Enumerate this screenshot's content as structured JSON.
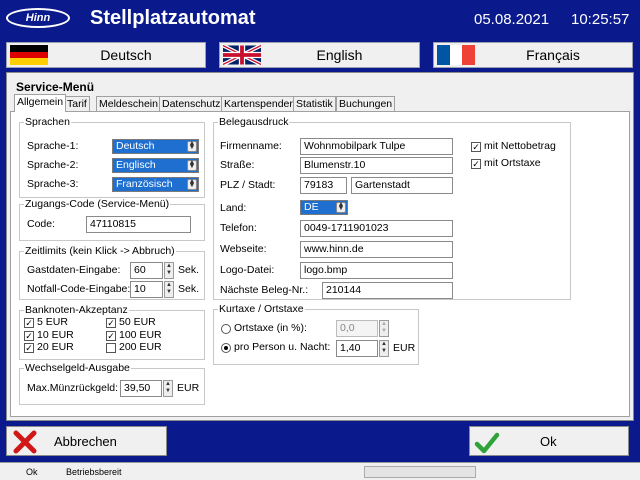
{
  "header": {
    "logo_text": "Hinn",
    "title": "Stellplatzautomat",
    "date": "05.08.2021",
    "time": "10:25:57"
  },
  "languages": [
    {
      "label": "Deutsch"
    },
    {
      "label": "English"
    },
    {
      "label": "Français"
    }
  ],
  "menu_title": "Service-Menü",
  "tabs": [
    "Allgemein",
    "Tarif",
    "Meldeschein",
    "Datenschutz",
    "Kartenspender",
    "Statistik",
    "Buchungen"
  ],
  "sprachen": {
    "legend": "Sprachen",
    "rows": [
      {
        "label": "Sprache-1:",
        "value": "Deutsch"
      },
      {
        "label": "Sprache-2:",
        "value": "Englisch"
      },
      {
        "label": "Sprache-3:",
        "value": "Französisch"
      }
    ]
  },
  "zugang": {
    "legend": "Zugangs-Code (Service-Menü)",
    "label": "Code:",
    "value": "47110815"
  },
  "zeitlimits": {
    "legend": "Zeitlimits (kein Klick -> Abbruch)",
    "rows": [
      {
        "label": "Gastdaten-Eingabe:",
        "value": "60",
        "unit": "Sek."
      },
      {
        "label": "Notfall-Code-Eingabe:",
        "value": "10",
        "unit": "Sek."
      }
    ]
  },
  "banknoten": {
    "legend": "Banknoten-Akzeptanz",
    "items": [
      {
        "label": "5 EUR",
        "checked": true
      },
      {
        "label": "50 EUR",
        "checked": true
      },
      {
        "label": "10 EUR",
        "checked": true
      },
      {
        "label": "100 EUR",
        "checked": true
      },
      {
        "label": "20 EUR",
        "checked": true
      },
      {
        "label": "200 EUR",
        "checked": false
      }
    ]
  },
  "wechselgeld": {
    "legend": "Wechselgeld-Ausgabe",
    "label": "Max.Münzrückgeld:",
    "value": "39,50",
    "unit": "EUR"
  },
  "beleg": {
    "legend": "Belegausdruck",
    "fields": [
      {
        "label": "Firmenname:",
        "value": "Wohnmobilpark Tulpe"
      },
      {
        "label": "Straße:",
        "value": "Blumenstr.10"
      },
      {
        "label": "PLZ / Stadt:",
        "value": "79183",
        "value2": "Gartenstadt"
      },
      {
        "label": "Land:",
        "value": "DE"
      },
      {
        "label": "Telefon:",
        "value": "0049-1711901023"
      },
      {
        "label": "Webseite:",
        "value": "www.hinn.de"
      },
      {
        "label": "Logo-Datei:",
        "value": "logo.bmp"
      },
      {
        "label": "Nächste Beleg-Nr.:",
        "value": "210144"
      }
    ],
    "checks": [
      {
        "label": "mit Nettobetrag",
        "checked": true
      },
      {
        "label": "mit Ortstaxe",
        "checked": true
      }
    ]
  },
  "kurtaxe": {
    "legend": "Kurtaxe / Ortstaxe",
    "options": [
      {
        "label": "Ortstaxe (in %):",
        "value": "0,0",
        "selected": false,
        "unit": ""
      },
      {
        "label": "pro Person u. Nacht:",
        "value": "1,40",
        "selected": true,
        "unit": "EUR"
      }
    ]
  },
  "buttons": {
    "cancel": "Abbrechen",
    "ok": "Ok"
  },
  "status": {
    "left": "Ok",
    "text": "Betriebsbereit"
  },
  "colors": {
    "background": "#0a1a8c",
    "panel": "#f0f0f0",
    "selection": "#1e6fd0",
    "ok_check": "#2fa33a",
    "cancel_x": "#d01818"
  },
  "icons": {
    "cancel": "red-x-icon",
    "ok": "green-check-icon"
  }
}
